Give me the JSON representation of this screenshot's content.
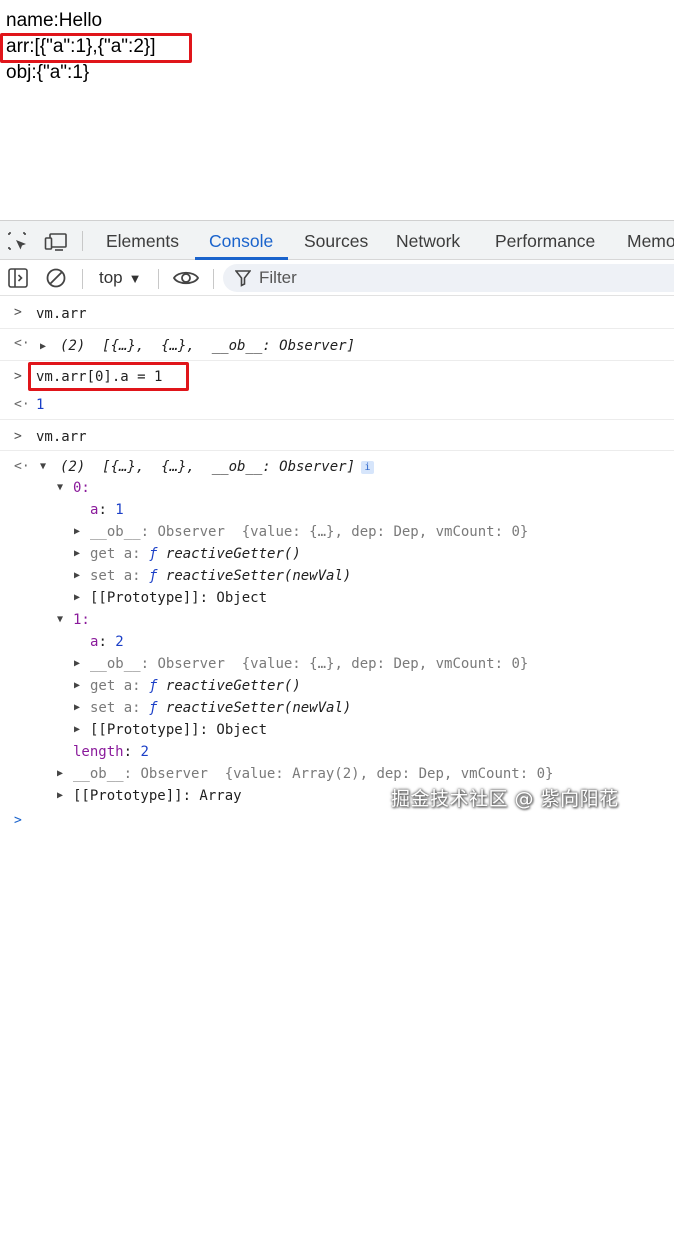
{
  "page": {
    "lines": [
      "name:Hello",
      "arr:[{\"a\":1},{\"a\":2}]",
      "obj:{\"a\":1}"
    ]
  },
  "devtools": {
    "tabs": [
      "Elements",
      "Console",
      "Sources",
      "Network",
      "Performance",
      "Memo"
    ],
    "active_tab": "Console",
    "context": "top",
    "filter_placeholder": "Filter"
  },
  "console": {
    "entry1_input": "vm.arr",
    "entry1_output": "(2)  [{…},  {…},  __ob__: Observer]",
    "entry2_input": "vm.arr[0].a = 1",
    "entry2_output": "1",
    "entry3_input": "vm.arr",
    "entry3_output": "(2)  [{…},  {…},  __ob__: Observer]",
    "info": "i",
    "tree": {
      "idx0": "0:",
      "idx0_a_key": "a",
      "idx0_a_val": "1",
      "ob_key": "__ob__",
      "ob_val": "Observer  {value: {…}, dep: Dep, vmCount: 0}",
      "get_label": "get a:",
      "getter": "reactiveGetter()",
      "set_label": "set a:",
      "setter": "reactiveSetter(newVal)",
      "proto_obj": "[[Prototype]]: Object",
      "idx1": "1:",
      "idx1_a_key": "a",
      "idx1_a_val": "2",
      "length_key": "length",
      "length_val": "2",
      "arr_ob_val": "Observer  {value: Array(2), dep: Dep, vmCount: 0}",
      "proto_arr": "[[Prototype]]: Array"
    }
  },
  "watermark": "掘金技术社区 @ 紫向阳花"
}
